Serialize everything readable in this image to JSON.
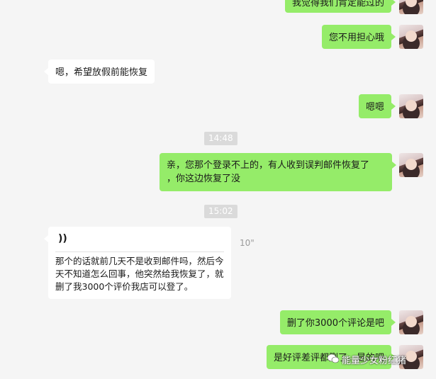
{
  "messages": {
    "m1": {
      "text": "我觉得我们肯定能过的"
    },
    "m2": {
      "text": "您不用担心哦"
    },
    "m3": {
      "text": "嗯，希望放假前能恢复"
    },
    "m4": {
      "text": "嗯嗯"
    },
    "t1": {
      "text": "14:48"
    },
    "m5": {
      "line1": "亲，您那个登录不上的，有人收到误判邮件恢复了",
      "line2": "，你这边恢复了没"
    },
    "t2": {
      "text": "15:02"
    },
    "m6": {
      "voice_icon": "))",
      "duration": "10\"",
      "transcript": "那个的话就前几天不是收到邮件吗，然后今天不知道怎么回事，他突然给我恢复了，就删了我3000个评价我店可以登了。"
    },
    "m7": {
      "text": "删了你3000个评论是吧"
    },
    "m8": {
      "text": "是好评差评都删了，是的吧"
    }
  },
  "watermark": {
    "icon": "wechat-icon",
    "text": "能量少女粉红猪"
  }
}
